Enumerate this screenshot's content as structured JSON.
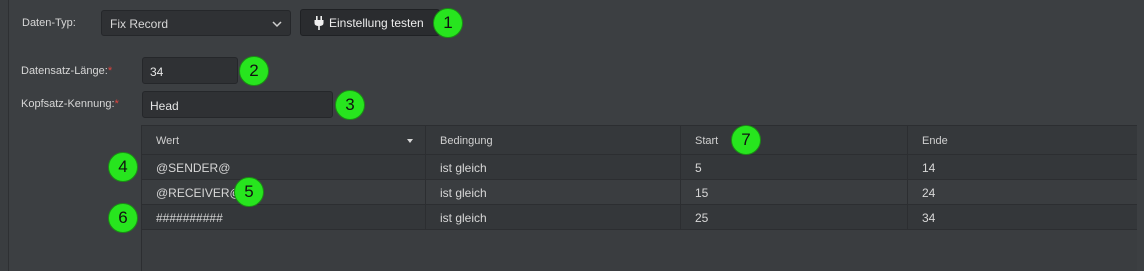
{
  "form": {
    "data_type_label": "Daten-Typ:",
    "data_type_value": "Fix Record",
    "test_button_label": "Einstellung testen",
    "record_length_label": "Datensatz-Länge:",
    "record_length_value": "34",
    "header_id_label": "Kopfsatz-Kennung:",
    "header_id_value": "Head",
    "required_marker": "*"
  },
  "table": {
    "columns": [
      "Wert",
      "Bedingung",
      "Start",
      "Ende"
    ],
    "sorted_column": "Wert",
    "rows": [
      [
        "@SENDER@",
        "ist gleich",
        "5",
        "14"
      ],
      [
        "@RECEIVER@",
        "ist gleich",
        "15",
        "24"
      ],
      [
        "##########",
        "ist gleich",
        "25",
        "34"
      ]
    ]
  },
  "badges": [
    "1",
    "2",
    "3",
    "4",
    "5",
    "6",
    "7"
  ],
  "colors": {
    "badge": "#27e51e",
    "required": "#e0443e",
    "background": "#3c3f42"
  },
  "icons": {
    "dropdown": "chevron-down-icon",
    "test_button": "plug-icon",
    "sort": "sort-caret-icon"
  }
}
